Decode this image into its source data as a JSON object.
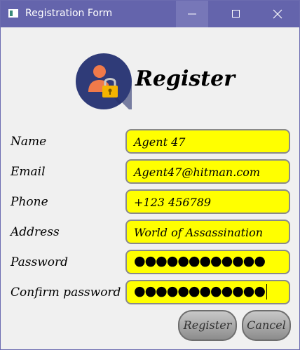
{
  "window": {
    "title": "Registration Form"
  },
  "header": {
    "heading": "Register",
    "logo_icon": "user-lock-icon"
  },
  "form": {
    "fields": [
      {
        "label": "Name",
        "value": "Agent 47"
      },
      {
        "label": "Email",
        "value": "Agent47@hitman.com"
      },
      {
        "label": "Phone",
        "value": "+123 456789"
      },
      {
        "label": "Address",
        "value": "World of Assassination"
      },
      {
        "label": "Password",
        "value": "●●●●●●●●●●●●"
      },
      {
        "label": "Confirm password",
        "value": "●●●●●●●●●●●●"
      }
    ]
  },
  "buttons": {
    "register": "Register",
    "cancel": "Cancel"
  },
  "colors": {
    "titlebar": "#6464ac",
    "field_background": "#ffff00",
    "window_background": "#f0f0f0",
    "logo_circle": "#2f3b78"
  }
}
